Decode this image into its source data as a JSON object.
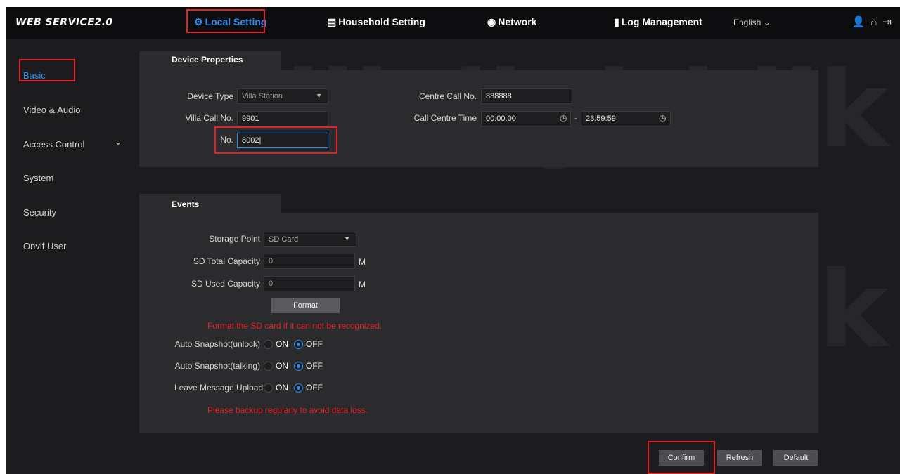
{
  "app": {
    "logo": "WEB SERVICE2.0"
  },
  "topnav": {
    "local_setting": "Local Setting",
    "household_setting": "Household Setting",
    "network": "Network",
    "log_management": "Log Management",
    "language": "English ⌄",
    "icons": [
      "user-icon",
      "home-icon",
      "logout-icon"
    ]
  },
  "sidebar": {
    "items": [
      {
        "label": "Basic",
        "active": true
      },
      {
        "label": "Video & Audio"
      },
      {
        "label": "Access Control",
        "expandable": true
      },
      {
        "label": "System"
      },
      {
        "label": "Security"
      },
      {
        "label": "Onvif User"
      }
    ]
  },
  "device_properties": {
    "tab_title": "Device Properties",
    "device_type": {
      "label": "Device Type",
      "value": "Villa Station"
    },
    "villa_call_no": {
      "label": "Villa Call No.",
      "value": "9901"
    },
    "no": {
      "label": "No.",
      "value": "8002|"
    },
    "centre_call_no": {
      "label": "Centre Call No.",
      "value": "888888"
    },
    "call_centre_time": {
      "label": "Call Centre Time",
      "start": "00:00:00",
      "separator": "-",
      "end": "23:59:59"
    }
  },
  "events": {
    "tab_title": "Events",
    "storage_point": {
      "label": "Storage Point",
      "value": "SD Card"
    },
    "sd_total_capacity": {
      "label": "SD Total Capacity",
      "value": "0",
      "unit": "M"
    },
    "sd_used_capacity": {
      "label": "SD Used Capacity",
      "value": "0",
      "unit": "M"
    },
    "format_button": "Format",
    "format_warning": "Format the SD card if it can not be recognized.",
    "auto_snapshot_unlock": {
      "label": "Auto Snapshot(unlock)",
      "on": "ON",
      "off": "OFF",
      "selected": "OFF"
    },
    "auto_snapshot_talking": {
      "label": "Auto Snapshot(talking)",
      "on": "ON",
      "off": "OFF",
      "selected": "OFF"
    },
    "leave_message_upload": {
      "label": "Leave Message Upload",
      "on": "ON",
      "off": "OFF",
      "selected": "OFF"
    },
    "backup_warning": "Please backup regularly to avoid data loss."
  },
  "actions": {
    "confirm": "Confirm",
    "refresh": "Refresh",
    "default": "Default"
  },
  "watermark": {
    "text": "digitklik"
  },
  "colors": {
    "accent": "#2a8ff0",
    "highlight": "#e0222a",
    "warning": "#e0222a",
    "background": "#1c1c1e",
    "panel": "#2b2b2e"
  }
}
